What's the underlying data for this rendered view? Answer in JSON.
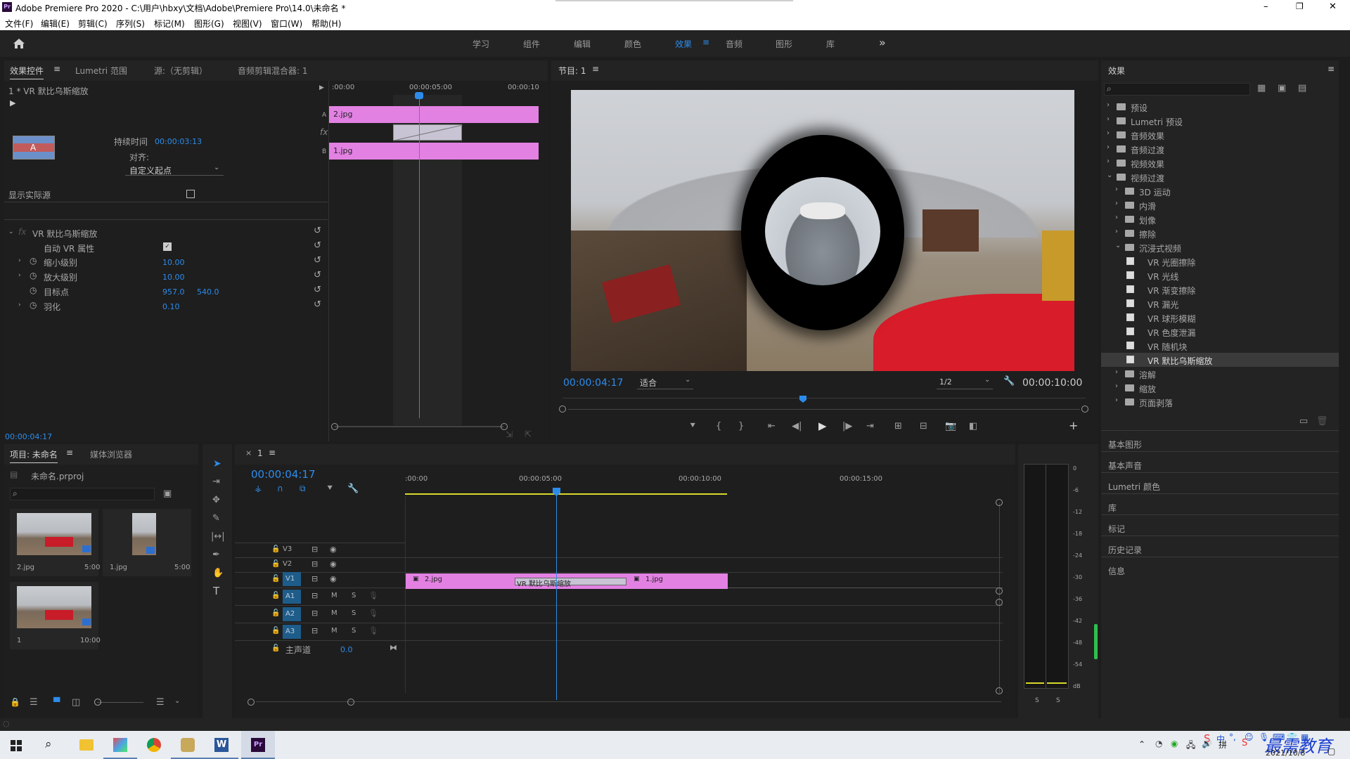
{
  "window": {
    "title": "Adobe Premiere Pro 2020 - C:\\用户\\hbxy\\文档\\Adobe\\Premiere Pro\\14.0\\未命名 *",
    "app_icon": "Pr"
  },
  "window_controls": {
    "minimize": "–",
    "maximize": "❐",
    "close": "✕"
  },
  "menu": [
    "文件(F)",
    "编辑(E)",
    "剪辑(C)",
    "序列(S)",
    "标记(M)",
    "图形(G)",
    "视图(V)",
    "窗口(W)",
    "帮助(H)"
  ],
  "workspaces": {
    "items": [
      "学习",
      "组件",
      "编辑",
      "颜色",
      "效果",
      "音频",
      "图形",
      "库"
    ],
    "active": "效果",
    "more": "»"
  },
  "effect_controls": {
    "tabs": [
      "效果控件",
      "Lumetri 范围",
      "源:（无剪辑）",
      "音频剪辑混合器: 1"
    ],
    "clip_name": "1 * VR 默比乌斯缩放",
    "duration_label": "持续时间",
    "duration_value": "00:00:03:13",
    "align_label": "对齐:",
    "align_value": "自定义起点",
    "show_source_label": "显示实际源",
    "effect_name": "VR 默比乌斯缩放",
    "props": [
      {
        "name": "自动 VR 属性",
        "value": "",
        "value2": ""
      },
      {
        "name": "缩小级别",
        "value": "10.00",
        "value2": ""
      },
      {
        "name": "放大级别",
        "value": "10.00",
        "value2": ""
      },
      {
        "name": "目标点",
        "value": "957.0",
        "value2": "540.0"
      },
      {
        "name": "羽化",
        "value": "0.10",
        "value2": ""
      }
    ],
    "current_time": "00:00:04:17",
    "mini_ruler": [
      ":00:00",
      "00:00:05:00",
      "00:00:10"
    ],
    "track_a_label": "A",
    "track_b_label": "B",
    "fx_label": "fx",
    "clip_a": "2.jpg",
    "clip_b": "1.jpg"
  },
  "program": {
    "title": "节目: 1",
    "current_time": "00:00:04:17",
    "zoom": "适合",
    "quality": "1/2",
    "duration": "00:00:10:00",
    "playhead_fraction": 0.46
  },
  "effects_panel": {
    "title": "效果",
    "tree": [
      {
        "label": "预设",
        "level": 0,
        "type": "folder",
        "open": false,
        "selected": false
      },
      {
        "label": "Lumetri 预设",
        "level": 0,
        "type": "folder",
        "open": false,
        "selected": false
      },
      {
        "label": "音频效果",
        "level": 0,
        "type": "folder",
        "open": false,
        "selected": false
      },
      {
        "label": "音频过渡",
        "level": 0,
        "type": "folder",
        "open": false,
        "selected": false
      },
      {
        "label": "视频效果",
        "level": 0,
        "type": "folder",
        "open": false,
        "selected": false
      },
      {
        "label": "视频过渡",
        "level": 0,
        "type": "folder",
        "open": true,
        "selected": false
      },
      {
        "label": "3D 运动",
        "level": 1,
        "type": "folder",
        "open": false,
        "selected": false
      },
      {
        "label": "内滑",
        "level": 1,
        "type": "folder",
        "open": false,
        "selected": false
      },
      {
        "label": "划像",
        "level": 1,
        "type": "folder",
        "open": false,
        "selected": false
      },
      {
        "label": "擦除",
        "level": 1,
        "type": "folder",
        "open": false,
        "selected": false
      },
      {
        "label": "沉浸式视频",
        "level": 1,
        "type": "folder",
        "open": true,
        "selected": false
      },
      {
        "label": "VR 光圈擦除",
        "level": 2,
        "type": "item",
        "open": false,
        "selected": false
      },
      {
        "label": "VR 光线",
        "level": 2,
        "type": "item",
        "open": false,
        "selected": false
      },
      {
        "label": "VR 渐变擦除",
        "level": 2,
        "type": "item",
        "open": false,
        "selected": false
      },
      {
        "label": "VR 漏光",
        "level": 2,
        "type": "item",
        "open": false,
        "selected": false
      },
      {
        "label": "VR 球形模糊",
        "level": 2,
        "type": "item",
        "open": false,
        "selected": false
      },
      {
        "label": "VR 色度泄漏",
        "level": 2,
        "type": "item",
        "open": false,
        "selected": false
      },
      {
        "label": "VR 随机块",
        "level": 2,
        "type": "item",
        "open": false,
        "selected": false
      },
      {
        "label": "VR 默比乌斯缩放",
        "level": 2,
        "type": "item",
        "open": false,
        "selected": true
      },
      {
        "label": "溶解",
        "level": 1,
        "type": "folder",
        "open": false,
        "selected": false
      },
      {
        "label": "缩放",
        "level": 1,
        "type": "folder",
        "open": false,
        "selected": false
      },
      {
        "label": "页面剥落",
        "level": 1,
        "type": "folder",
        "open": false,
        "selected": false
      }
    ],
    "extra_panels": [
      "基本图形",
      "基本声音",
      "Lumetri 颜色",
      "库",
      "标记",
      "历史记录",
      "信息"
    ]
  },
  "project": {
    "tabs": [
      "项目: 未命名",
      "媒体浏览器"
    ],
    "file": "未命名.prproj",
    "items": [
      {
        "name": "2.jpg",
        "duration": "5:00"
      },
      {
        "name": "1.jpg",
        "duration": "5:00"
      },
      {
        "name": "1",
        "duration": "10:00"
      }
    ]
  },
  "timeline": {
    "sequence_name": "1",
    "current_time": "00:00:04:17",
    "ruler": [
      ":00:00",
      "00:00:05:00",
      "00:00:10:00",
      "00:00:15:00"
    ],
    "video_tracks": [
      "V3",
      "V2",
      "V1"
    ],
    "audio_tracks": [
      "A1",
      "A2",
      "A3"
    ],
    "master_label": "主声道",
    "master_value": "0.0",
    "clips": {
      "clip1": "2.jpg",
      "transition": "VR 默比乌斯缩放",
      "clip2": "1.jpg"
    }
  },
  "meter": {
    "scale": [
      "0",
      "-6",
      "-12",
      "-18",
      "-24",
      "-30",
      "-36",
      "-42",
      "-48",
      "-54",
      "dB"
    ],
    "solo": [
      "S",
      "S"
    ]
  },
  "taskbar": {
    "date": "2021/10/8",
    "watermark": "最需教育",
    "ime": "中"
  },
  "colors": {
    "accent": "#2d8ceb",
    "clip": "#e381e3",
    "panel": "#232323",
    "bg": "#1d1d1d"
  }
}
